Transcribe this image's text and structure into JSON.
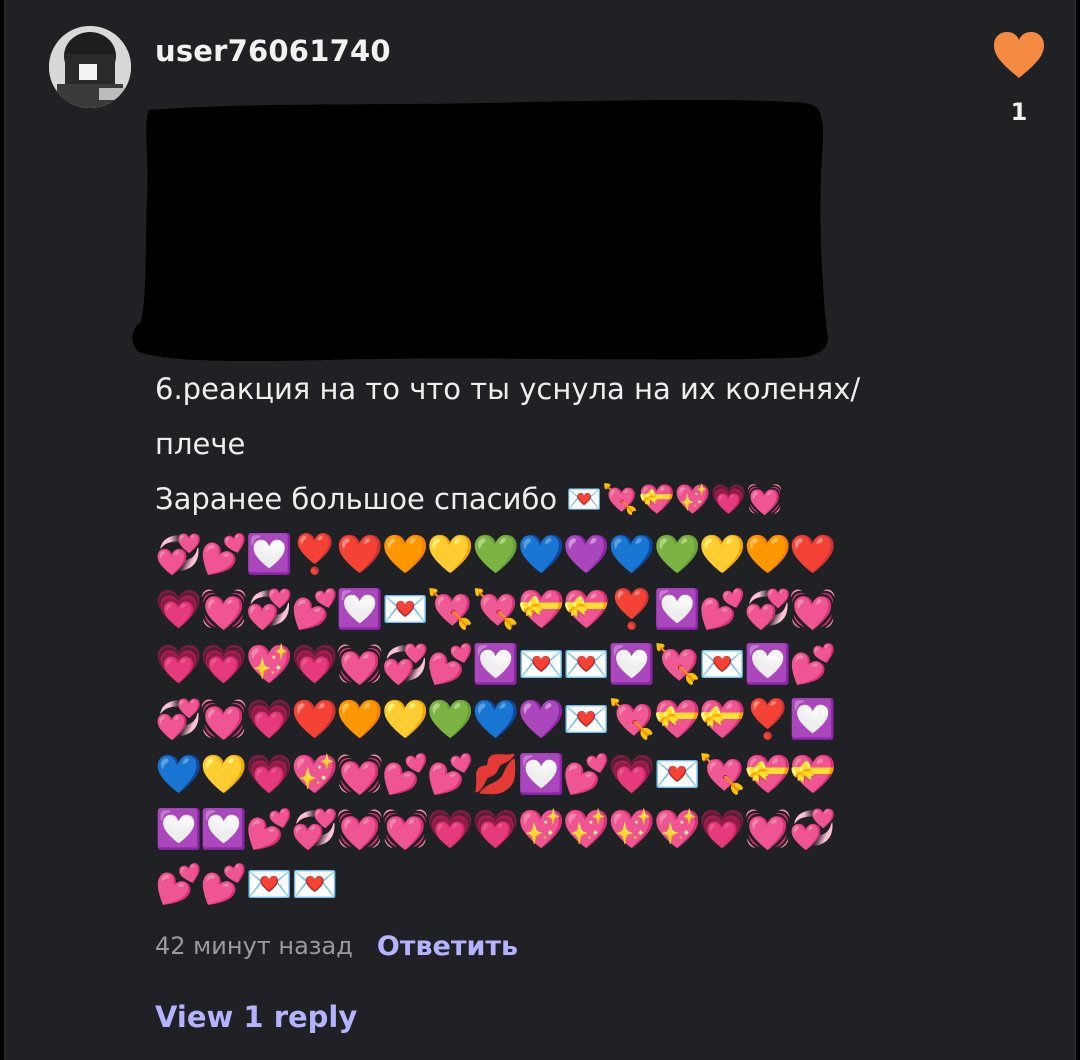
{
  "comment": {
    "username": "user76061740",
    "likes": {
      "count": "1",
      "icon": "heart-icon",
      "color": "#f58a42"
    },
    "text_lines": [
      "6.реакция на то что ты уснула на их коленях/",
      "плече",
      "Заранее большое спасибо 💌💘💝💖💗💓"
    ],
    "emoji_lines": [
      "💞💕💟❣️❤️🧡💛💚💙💜💙💚💛🧡❤️",
      "💗💓💞💕💟💌💘💘💝💝❣️💟💕💞💓",
      "💗💗💖💗💓💞💕💟💌💌💟💘💌💟💕",
      "💞💓💗❤️🧡💛💚💙💜💌💘💝💝❣️💟",
      "💙💛💗💖💓💕💕💋💟💕💗💌💘💝💝",
      "💟💟💕💞💓💓💗💗💖💖💖💖💗💓💞",
      "💕💕💌💌"
    ],
    "time_ago": "42 минут назад",
    "reply_label": "Ответить",
    "view_replies_label": "View 1 reply"
  },
  "colors": {
    "background": "#1f2124",
    "link": "#b3b3ff",
    "like_heart": "#f58a42"
  }
}
